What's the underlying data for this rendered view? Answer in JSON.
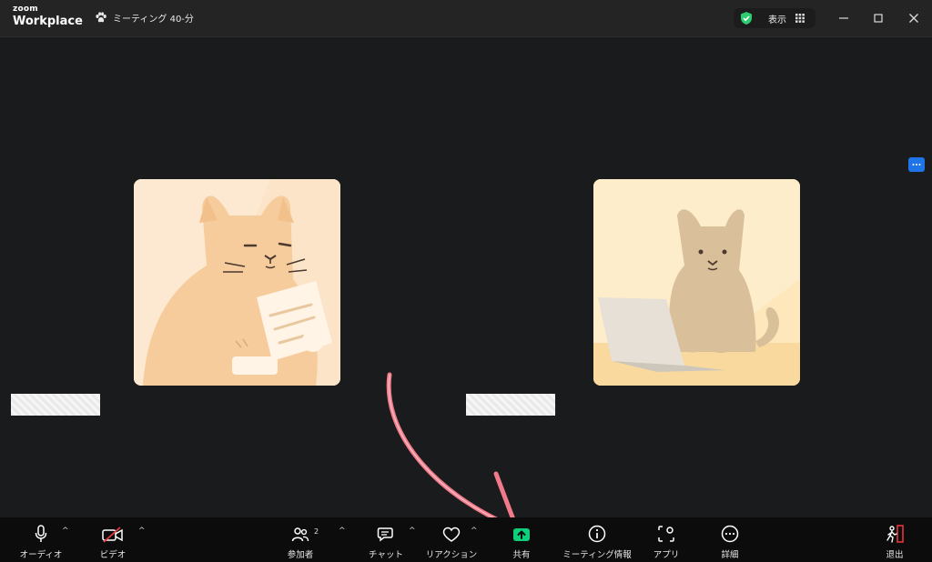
{
  "titlebar": {
    "logo_small": "zoom",
    "logo_big": "Workplace",
    "meeting_title": "ミーティング 40-分",
    "view_label": "表示",
    "icons": [
      "paw-icon",
      "shield-check-icon",
      "grid-icon",
      "minimize-icon",
      "maximize-icon",
      "close-icon"
    ]
  },
  "stage": {
    "participants": [
      {
        "illustration": "cat-reading-paper"
      },
      {
        "illustration": "cat-with-laptop"
      }
    ],
    "side_button_icon": "more-horizontal-icon"
  },
  "toolbar": {
    "audio": {
      "label": "オーディオ",
      "icon": "microphone-icon"
    },
    "video": {
      "label": "ビデオ",
      "icon": "video-off-icon"
    },
    "participants": {
      "label": "参加者",
      "count": "2",
      "icon": "participants-icon"
    },
    "chat": {
      "label": "チャット",
      "icon": "chat-icon"
    },
    "reactions": {
      "label": "リアクション",
      "icon": "heart-icon"
    },
    "share": {
      "label": "共有",
      "icon": "share-screen-icon"
    },
    "info": {
      "label": "ミーティング情報",
      "icon": "info-icon"
    },
    "apps": {
      "label": "アプリ",
      "icon": "apps-icon"
    },
    "more": {
      "label": "詳細",
      "icon": "more-icon"
    },
    "leave": {
      "label": "退出",
      "icon": "leave-icon"
    }
  },
  "colors": {
    "background": "#1a1b1d",
    "toolbar": "#0c0c0c",
    "share_accent": "#0ecf7a",
    "leave_accent": "#e5363c",
    "annotation_arrow": "#f07a8a",
    "shield": "#2ecc71"
  }
}
